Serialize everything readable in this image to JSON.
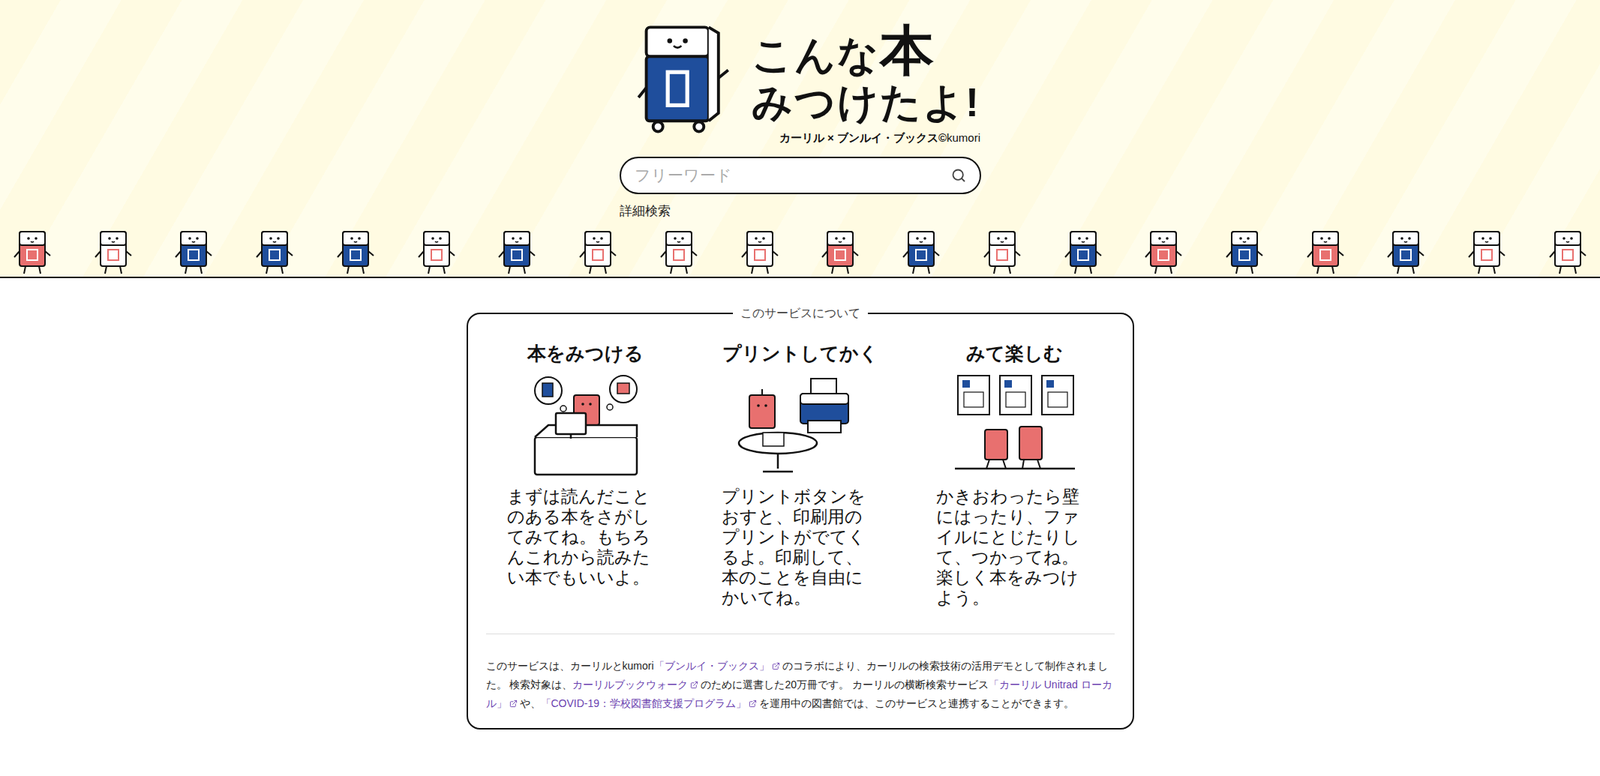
{
  "logo": {
    "lead": "こんな",
    "emphasis": "本",
    "line2": "みつけたよ!",
    "credit": "カーリル × ブンルイ・ブックス©",
    "credit_brand": "kumori"
  },
  "search": {
    "placeholder": "フリーワード"
  },
  "advanced_search_link": "詳細検索",
  "characters": [
    {
      "color": "#e8706f"
    },
    {
      "color": "#ffffff"
    },
    {
      "color": "#1f4e9c"
    },
    {
      "color": "#1f4e9c"
    },
    {
      "color": "#1f4e9c"
    },
    {
      "color": "#ffffff"
    },
    {
      "color": "#1f4e9c"
    },
    {
      "color": "#ffffff"
    },
    {
      "color": "#ffffff"
    },
    {
      "color": "#ffffff"
    },
    {
      "color": "#e8706f"
    },
    {
      "color": "#1f4e9c"
    },
    {
      "color": "#ffffff"
    },
    {
      "color": "#1f4e9c"
    },
    {
      "color": "#e8706f"
    },
    {
      "color": "#1f4e9c"
    },
    {
      "color": "#e8706f"
    },
    {
      "color": "#1f4e9c"
    },
    {
      "color": "#ffffff"
    },
    {
      "color": "#ffffff"
    }
  ],
  "about": {
    "legend": "このサービスについて",
    "steps": [
      {
        "title": "本をみつける",
        "text": "まずは読んだことのある本をさがしてみてね。もちろんこれから読みたい本でもいいよ。"
      },
      {
        "title": "プリントしてかく",
        "text": "プリントボタンをおすと、印刷用のプリントがでてくるよ。印刷して、本のことを自由にかいてね。"
      },
      {
        "title": "みて楽しむ",
        "text": "かきおわったら壁にはったり、ファイルにとじたりして、つかってね。楽しく本をみつけよう。"
      }
    ],
    "footer": [
      {
        "text": "このサービスは、カーリルとkumori",
        "link": false
      },
      {
        "text": "「ブンルイ・ブックス」",
        "link": true
      },
      {
        "text": "のコラボにより、カーリルの検索技術の活用デモとして制作されました。 検索対象は、",
        "link": false
      },
      {
        "text": "カーリルブックウォーク",
        "link": true
      },
      {
        "text": "のために選書した20万冊です。 カーリルの横断検索サービス",
        "link": false
      },
      {
        "text": "「カーリル Unitrad ローカル」",
        "link": true
      },
      {
        "text": "や、",
        "link": false
      },
      {
        "text": "「COVID-19：学校図書館支援プログラム」",
        "link": true
      },
      {
        "text": "を運用中の図書館では、このサービスと連携することができます。",
        "link": false
      }
    ]
  }
}
